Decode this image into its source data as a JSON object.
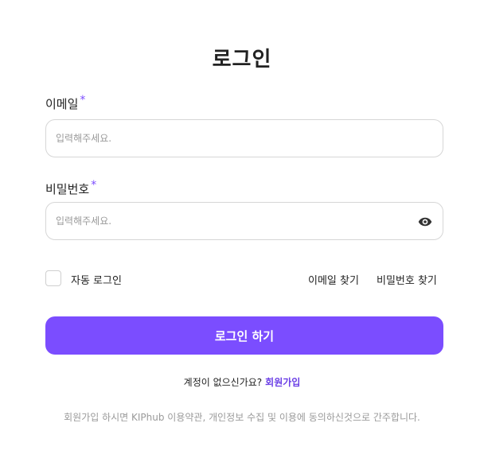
{
  "title": "로그인",
  "email": {
    "label": "이메일",
    "required_mark": "*",
    "placeholder": "입력해주세요."
  },
  "password": {
    "label": "비밀번호",
    "required_mark": "*",
    "placeholder": "입력해주세요.",
    "toggle_icon": "eye-icon"
  },
  "options": {
    "auto_login_label": "자동 로그인",
    "auto_login_checked": false,
    "find_email_label": "이메일 찾기",
    "find_password_label": "비밀번호 찾기"
  },
  "login_button_label": "로그인 하기",
  "signup": {
    "prompt": "계정이 없으신가요?",
    "link_label": "회원가입"
  },
  "notice": "회원가입 하시면 KIPhub 이용약관, 개인정보 수집 및 이용에 동의하신것으로 간주합니다.",
  "colors": {
    "accent": "#7b4dff",
    "link": "#6a3ee6",
    "muted_text": "#9a9a9a",
    "border": "#d6d6d6"
  }
}
